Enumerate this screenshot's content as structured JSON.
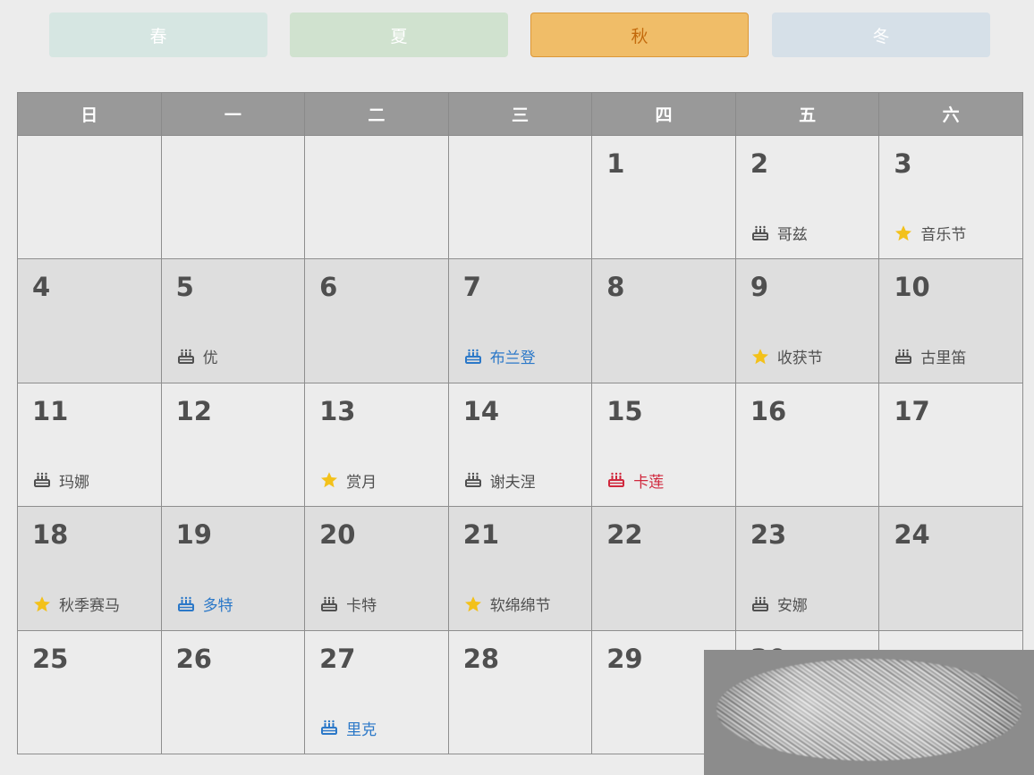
{
  "seasons": [
    {
      "key": "spring",
      "label": "春",
      "active": false
    },
    {
      "key": "summer",
      "label": "夏",
      "active": false
    },
    {
      "key": "autumn",
      "label": "秋",
      "active": true
    },
    {
      "key": "winter",
      "label": "冬",
      "active": false
    }
  ],
  "weekdays": [
    "日",
    "一",
    "二",
    "三",
    "四",
    "五",
    "六"
  ],
  "weeks": [
    {
      "shade": "light",
      "days": [
        null,
        null,
        null,
        null,
        {
          "day": "1"
        },
        {
          "day": "2",
          "event": {
            "type": "birthday",
            "label": "哥兹",
            "tone": "gray"
          }
        },
        {
          "day": "3",
          "event": {
            "type": "festival",
            "label": "音乐节",
            "tone": "gray"
          }
        }
      ]
    },
    {
      "shade": "dark",
      "days": [
        {
          "day": "4"
        },
        {
          "day": "5",
          "event": {
            "type": "birthday",
            "label": "优",
            "tone": "gray"
          }
        },
        {
          "day": "6"
        },
        {
          "day": "7",
          "event": {
            "type": "birthday",
            "label": "布兰登",
            "tone": "blue"
          }
        },
        {
          "day": "8"
        },
        {
          "day": "9",
          "event": {
            "type": "festival",
            "label": "收获节",
            "tone": "gray"
          }
        },
        {
          "day": "10",
          "event": {
            "type": "birthday",
            "label": "古里笛",
            "tone": "gray"
          }
        }
      ]
    },
    {
      "shade": "light",
      "days": [
        {
          "day": "11",
          "event": {
            "type": "birthday",
            "label": "玛娜",
            "tone": "gray"
          }
        },
        {
          "day": "12"
        },
        {
          "day": "13",
          "event": {
            "type": "festival",
            "label": "赏月",
            "tone": "gray"
          }
        },
        {
          "day": "14",
          "event": {
            "type": "birthday",
            "label": "谢夫涅",
            "tone": "gray"
          }
        },
        {
          "day": "15",
          "event": {
            "type": "birthday",
            "label": "卡莲",
            "tone": "red"
          }
        },
        {
          "day": "16"
        },
        {
          "day": "17"
        }
      ]
    },
    {
      "shade": "dark",
      "days": [
        {
          "day": "18",
          "event": {
            "type": "festival",
            "label": "秋季赛马",
            "tone": "gray"
          }
        },
        {
          "day": "19",
          "event": {
            "type": "birthday",
            "label": "多特",
            "tone": "blue"
          }
        },
        {
          "day": "20",
          "event": {
            "type": "birthday",
            "label": "卡特",
            "tone": "gray"
          }
        },
        {
          "day": "21",
          "event": {
            "type": "festival",
            "label": "软绵绵节",
            "tone": "gray"
          }
        },
        {
          "day": "22"
        },
        {
          "day": "23",
          "event": {
            "type": "birthday",
            "label": "安娜",
            "tone": "gray"
          }
        },
        {
          "day": "24"
        }
      ]
    },
    {
      "shade": "light",
      "days": [
        {
          "day": "25"
        },
        {
          "day": "26"
        },
        {
          "day": "27",
          "event": {
            "type": "birthday",
            "label": "里克",
            "tone": "blue"
          }
        },
        {
          "day": "28"
        },
        {
          "day": "29"
        },
        {
          "day": "30"
        },
        null
      ]
    }
  ],
  "colors": {
    "gray_event": "#505050",
    "blue_event": "#2b78c8",
    "red_event": "#d0283d",
    "star": "#f3c11a",
    "header_bg": "#999999",
    "active_tab": "#f0bd68"
  },
  "icons": {
    "birthday": "birthday-cake-icon",
    "festival": "star-icon"
  }
}
